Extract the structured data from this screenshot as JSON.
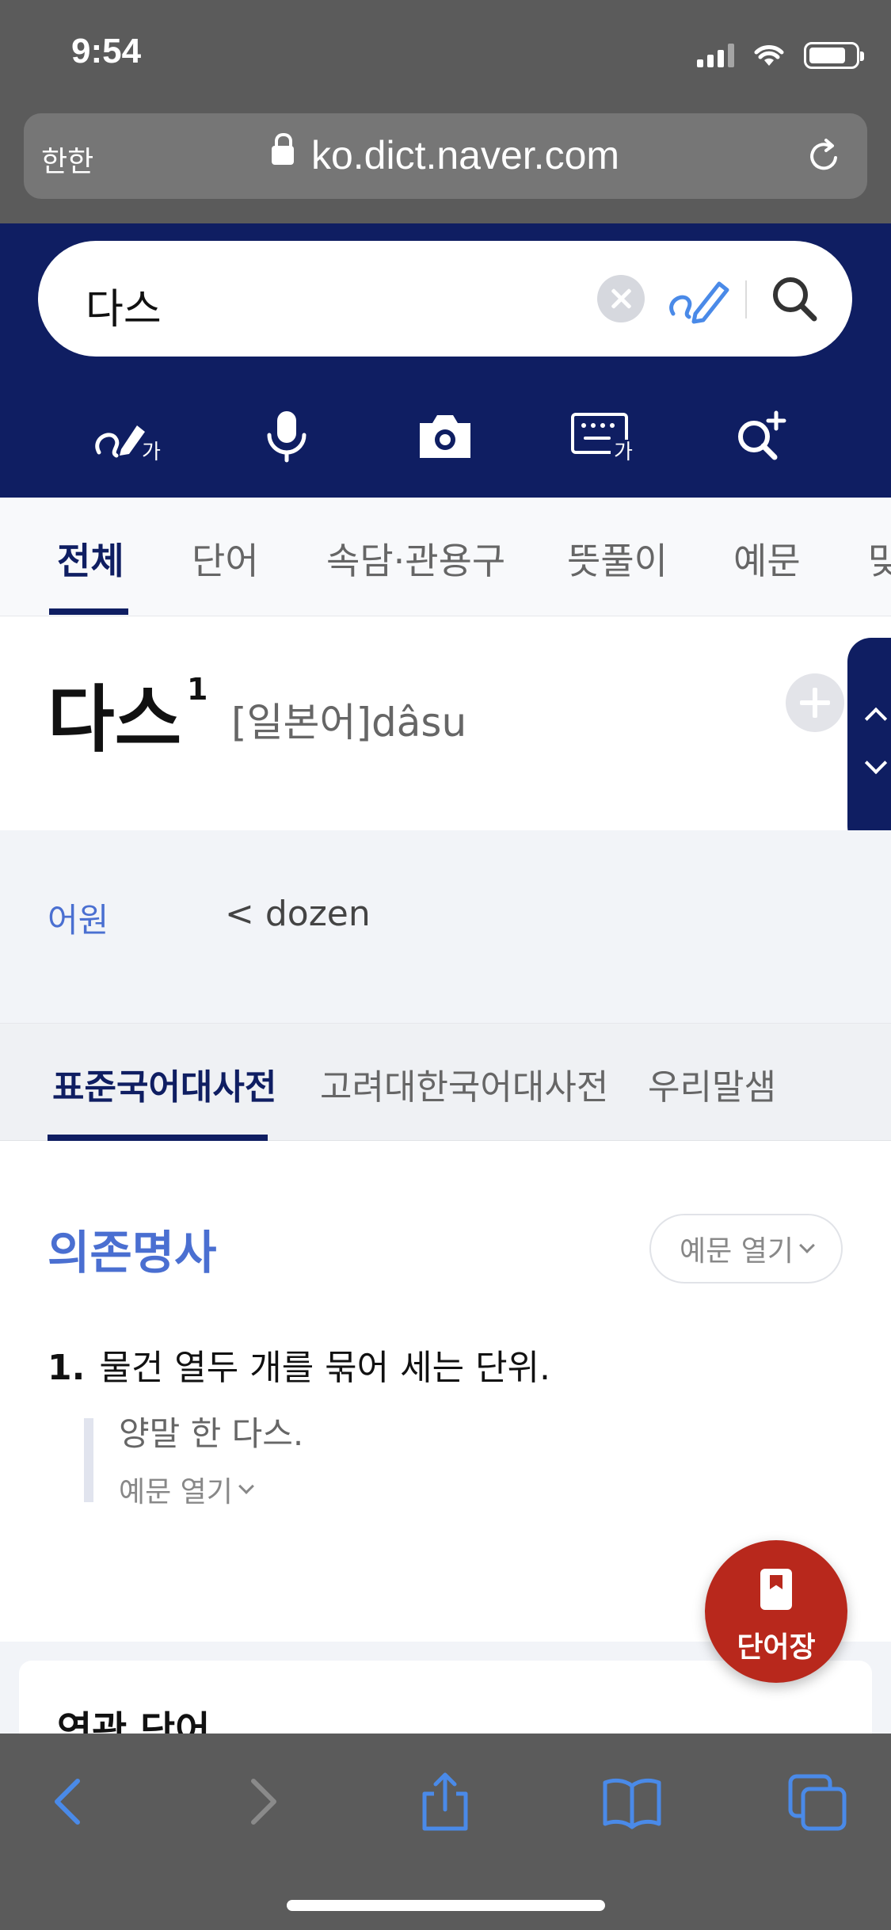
{
  "status_bar": {
    "time": "9:54"
  },
  "browser": {
    "left_label": "한한",
    "url": "ko.dict.naver.com"
  },
  "search": {
    "query": "다스"
  },
  "tabs": [
    {
      "label": "전체",
      "active": true
    },
    {
      "label": "단어"
    },
    {
      "label": "속담·관용구"
    },
    {
      "label": "뜻풀이"
    },
    {
      "label": "예문"
    },
    {
      "label": "맞"
    }
  ],
  "entry": {
    "headword": "다스",
    "superscript": "1",
    "origin": "[일본어]dâsu"
  },
  "etymology": {
    "label": "어원",
    "value": "< dozen"
  },
  "dict_tabs": [
    {
      "label": "표준국어대사전",
      "active": true
    },
    {
      "label": "고려대한국어대사전"
    },
    {
      "label": "우리말샘"
    }
  ],
  "meaning": {
    "part_of_speech": "의존명사",
    "examples_toggle": "예문 열기",
    "definition_number": "1.",
    "definition": "물건 열두 개를 묶어 세는 단위.",
    "example": "양말 한 다스.",
    "example_toggle": "예문 열기"
  },
  "fab": {
    "label": "단어장"
  },
  "related": {
    "title": "연관 단어"
  },
  "colors": {
    "header_navy": "#0f1e62",
    "accent_blue": "#4a6fd1",
    "fab_red": "#b8281c",
    "chrome_gray": "#5b5b5b"
  }
}
